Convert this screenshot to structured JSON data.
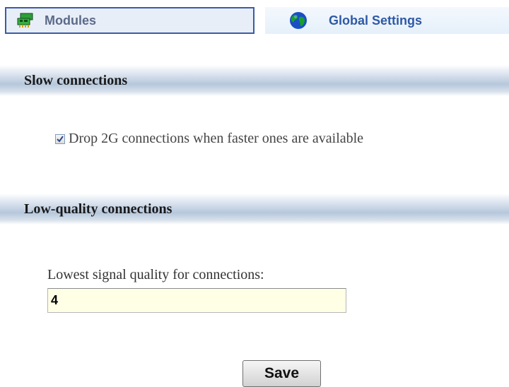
{
  "tabs": {
    "modules": {
      "label": "Modules",
      "icon": "network-card-icon",
      "active": true
    },
    "global": {
      "label": "Global Settings",
      "icon": "globe-icon",
      "active": false
    }
  },
  "sections": {
    "slow": {
      "title": "Slow connections",
      "checkbox": {
        "label": "Drop 2G connections when faster ones are available",
        "checked": true
      }
    },
    "low_quality": {
      "title": "Low-quality connections",
      "field": {
        "label": "Lowest signal quality for connections:",
        "value": "4"
      }
    }
  },
  "actions": {
    "save_label": "Save"
  },
  "colors": {
    "tab_active_border": "#3b5ba8",
    "tab_active_bg": "#e8eef8",
    "tab_global_text": "#2e59a6",
    "section_header_mid": "#b6c8dc",
    "input_bg": "#ffffe6"
  }
}
